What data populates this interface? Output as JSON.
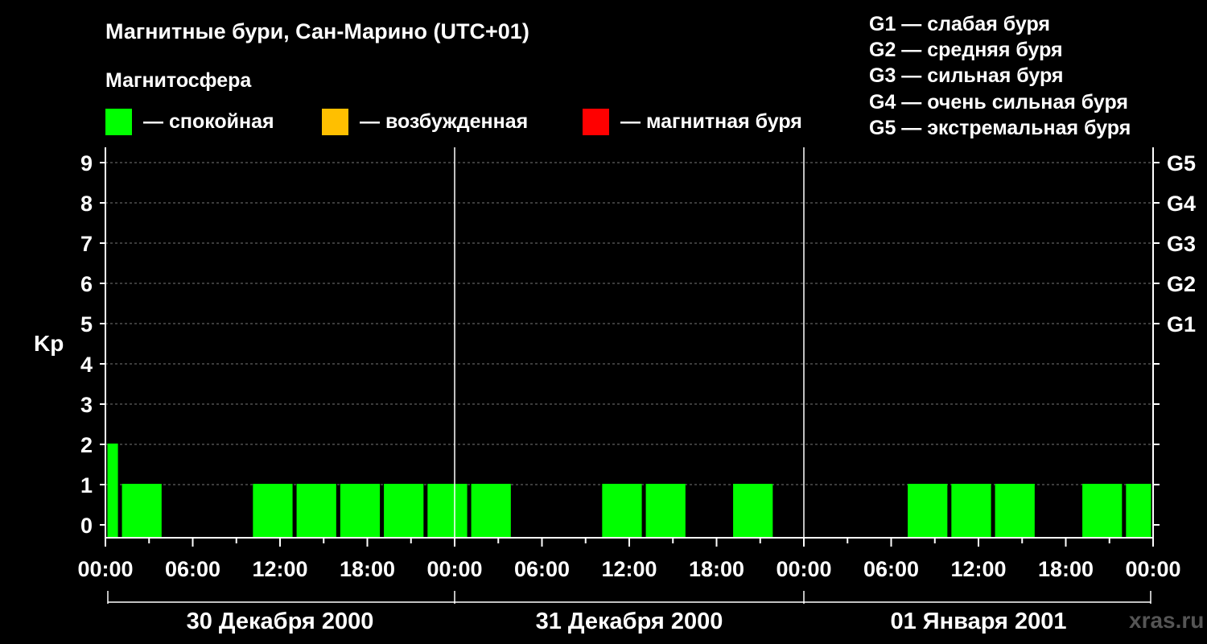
{
  "title": "Магнитные бури, Сан-Марино (UTC+01)",
  "subtitle": "Магнитосфера",
  "legend": [
    {
      "label": "— спокойная",
      "color": "#00ff00"
    },
    {
      "label": "— возбужденная",
      "color": "#ffbf00"
    },
    {
      "label": "— магнитная буря",
      "color": "#ff0000"
    }
  ],
  "storm_levels": [
    "G1 — слабая буря",
    "G2 — средняя буря",
    "G3 — сильная буря",
    "G4 — очень сильная буря",
    "G5 — экстремальная буря"
  ],
  "watermark": "xras.ru",
  "chart_data": {
    "type": "bar",
    "ylabel": "Kp",
    "ylim": [
      0,
      9
    ],
    "yticks": [
      0,
      1,
      2,
      3,
      4,
      5,
      6,
      7,
      8,
      9
    ],
    "right_ticks": [
      {
        "value": 5,
        "label": "G1"
      },
      {
        "value": 6,
        "label": "G2"
      },
      {
        "value": 7,
        "label": "G3"
      },
      {
        "value": 8,
        "label": "G4"
      },
      {
        "value": 9,
        "label": "G5"
      }
    ],
    "xlim_hours": [
      0,
      72
    ],
    "xtick_labels": [
      "00:00",
      "06:00",
      "12:00",
      "18:00",
      "00:00",
      "06:00",
      "12:00",
      "18:00",
      "00:00",
      "06:00",
      "12:00",
      "18:00",
      "00:00"
    ],
    "days": [
      "30 Декабря 2000",
      "31 Декабря 2000",
      "01 Января 2001"
    ],
    "grid": "horizontal dashed",
    "color": "#00ff00",
    "bars": [
      {
        "start": 0,
        "end": 1,
        "kp": 2
      },
      {
        "start": 1,
        "end": 4,
        "kp": 1
      },
      {
        "start": 10,
        "end": 13,
        "kp": 1
      },
      {
        "start": 13,
        "end": 16,
        "kp": 1
      },
      {
        "start": 16,
        "end": 19,
        "kp": 1
      },
      {
        "start": 19,
        "end": 22,
        "kp": 1
      },
      {
        "start": 22,
        "end": 25,
        "kp": 1
      },
      {
        "start": 25,
        "end": 28,
        "kp": 1
      },
      {
        "start": 34,
        "end": 37,
        "kp": 1
      },
      {
        "start": 37,
        "end": 40,
        "kp": 1
      },
      {
        "start": 43,
        "end": 46,
        "kp": 1
      },
      {
        "start": 55,
        "end": 58,
        "kp": 1
      },
      {
        "start": 58,
        "end": 61,
        "kp": 1
      },
      {
        "start": 61,
        "end": 64,
        "kp": 1
      },
      {
        "start": 67,
        "end": 70,
        "kp": 1
      },
      {
        "start": 70,
        "end": 72,
        "kp": 1
      }
    ]
  }
}
